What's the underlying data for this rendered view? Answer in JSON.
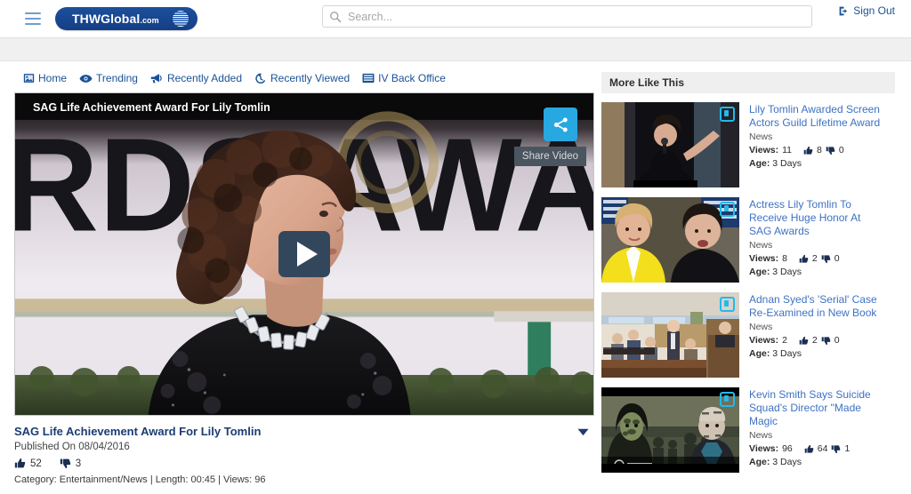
{
  "header": {
    "menu_icon": "hamburger-icon",
    "logo_text": "THWGlobal",
    "logo_suffix": ".com",
    "search_placeholder": "Search...",
    "search_value": "",
    "signout_label": "Sign Out"
  },
  "nav": {
    "items": [
      {
        "label": "Home",
        "icon": "home-icon"
      },
      {
        "label": "Trending",
        "icon": "eye-icon"
      },
      {
        "label": "Recently Added",
        "icon": "megaphone-icon"
      },
      {
        "label": "Recently Viewed",
        "icon": "history-icon"
      },
      {
        "label": "IV Back Office",
        "icon": "list-icon"
      }
    ]
  },
  "player": {
    "overlay_title": "SAG Life Achievement Award For Lily Tomlin",
    "share_tooltip": "Share Video",
    "share_icon": "share-icon",
    "play_icon": "play-icon"
  },
  "video": {
    "title": "SAG Life Achievement Award For Lily Tomlin",
    "published": "Published On 08/04/2016",
    "likes": "52",
    "dislikes": "3",
    "details": "Category: Entertainment/News | Length: 00:45 | Views: 96",
    "caret_icon": "chevron-down-icon"
  },
  "sidebar": {
    "title": "More Like This",
    "items": [
      {
        "title": "Lily Tomlin Awarded Screen Actors Guild Lifetime Award",
        "category": "News",
        "views_label": "Views:",
        "views": "11",
        "likes": "8",
        "dislikes": "0",
        "age_label": "Age:",
        "age": "3 Days"
      },
      {
        "title": "Actress Lily Tomlin To Receive Huge Honor At SAG Awards",
        "category": "News",
        "views_label": "Views:",
        "views": "8",
        "likes": "2",
        "dislikes": "0",
        "age_label": "Age:",
        "age": "3 Days"
      },
      {
        "title": "Adnan Syed's 'Serial' Case Re-Examined in New Book",
        "category": "News",
        "views_label": "Views:",
        "views": "2",
        "likes": "2",
        "dislikes": "0",
        "age_label": "Age:",
        "age": "3 Days"
      },
      {
        "title": "Kevin Smith Says Suicide Squad's Director \"Made Magic",
        "category": "News",
        "views_label": "Views:",
        "views": "96",
        "likes": "64",
        "dislikes": "1",
        "age_label": "Age:",
        "age": "3 Days"
      }
    ]
  },
  "colors": {
    "brand_blue": "#1d4f9c",
    "link_blue": "#3d72c4",
    "nav_blue": "#1a5296",
    "share_cyan": "#27a8e0",
    "badge_cyan": "#22b9ef",
    "gray_band": "#f0f0f0"
  }
}
